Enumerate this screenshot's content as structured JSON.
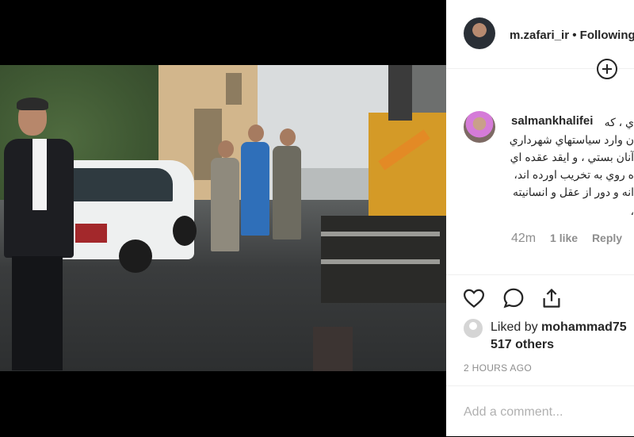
{
  "post": {
    "author": "m.zafari_ir",
    "separator": "•",
    "follow_label": "Following"
  },
  "comment": {
    "username": "salmankhalifei",
    "lines": [
      "ي ، كه",
      "ن وارد سياستهاي شهرداري",
      "آنان بستي ، و ايقد عقده اي",
      "ه روي به تخريب اورده اند،",
      "انه و دور از عقل و انسانيته",
      "،"
    ],
    "time": "42m",
    "likes": "1 like",
    "reply_label": "Reply"
  },
  "actions": {
    "icons": [
      "heart-icon",
      "comment-icon",
      "share-icon"
    ]
  },
  "likes": {
    "prefix": "Liked by",
    "user": "mohammad75",
    "others": "517 others"
  },
  "posted_ago": "2 HOURS AGO",
  "add_comment": {
    "placeholder": "Add a comment..."
  }
}
